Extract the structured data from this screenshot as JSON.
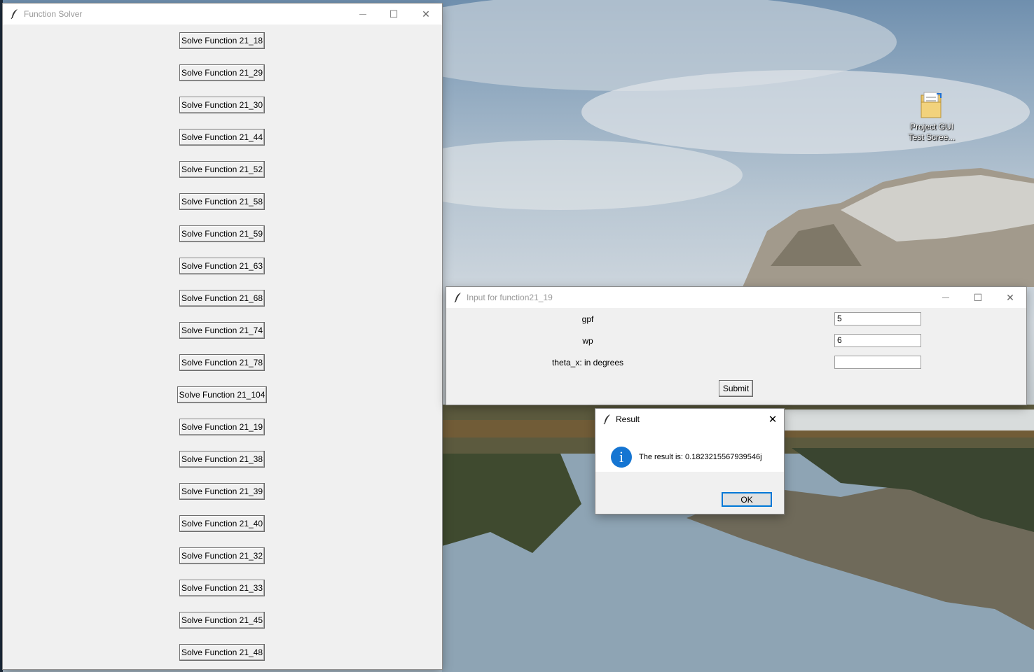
{
  "desktop": {
    "icon_label_line1": "Project GUI",
    "icon_label_line2": "Test Scree..."
  },
  "solver_window": {
    "title": "Function Solver",
    "buttons": [
      "Solve Function 21_18",
      "Solve Function 21_29",
      "Solve Function 21_30",
      "Solve Function 21_44",
      "Solve Function 21_52",
      "Solve Function 21_58",
      "Solve Function 21_59",
      "Solve Function 21_63",
      "Solve Function 21_68",
      "Solve Function 21_74",
      "Solve Function 21_78",
      "Solve Function 21_104",
      "Solve Function 21_19",
      "Solve Function 21_38",
      "Solve Function 21_39",
      "Solve Function 21_40",
      "Solve Function 21_32",
      "Solve Function 21_33",
      "Solve Function 21_45",
      "Solve Function 21_48"
    ]
  },
  "input_window": {
    "title": "Input for function21_19",
    "fields": [
      {
        "label": "gpf",
        "value": "5"
      },
      {
        "label": "wp",
        "value": "6"
      },
      {
        "label": "theta_x: in degrees",
        "value": ""
      }
    ],
    "submit_label": "Submit"
  },
  "result_dialog": {
    "title": "Result",
    "icon_glyph": "i",
    "message": "The result is: 0.1823215567939546j",
    "ok_label": "OK"
  },
  "titlebar_glyphs": {
    "minimize": "—",
    "maximize": "☐",
    "close": "✕"
  }
}
